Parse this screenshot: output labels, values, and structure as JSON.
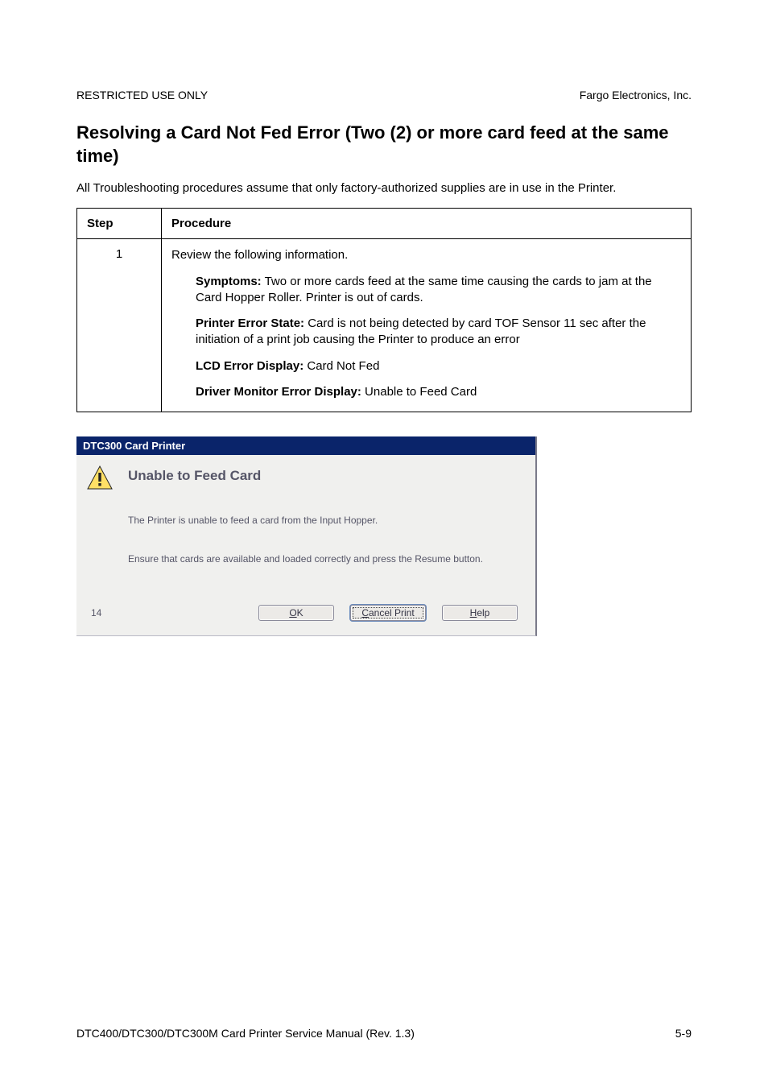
{
  "header": {
    "left": "RESTRICTED USE ONLY",
    "right": "Fargo Electronics, Inc."
  },
  "section_title": "Resolving a Card Not Fed Error (Two (2) or more card feed at the same time)",
  "intro": "All Troubleshooting procedures assume that only factory-authorized supplies are in use in the Printer.",
  "proc_table": {
    "headers": {
      "step": "Step",
      "procedure": "Procedure"
    },
    "row": {
      "step": "1",
      "line1": "Review the following information.",
      "symptoms_label": "Symptoms:",
      "symptoms_text": " Two or more cards feed at the same time causing the cards to jam at the Card Hopper Roller. Printer is out of cards.",
      "error_state_label": "Printer Error State:",
      "error_state_text": " Card is not being detected by card TOF Sensor 11 sec after the initiation of a print job causing the Printer to produce an error",
      "lcd_label": "LCD Error Display:",
      "lcd_text": " Card Not Fed",
      "driver_label": "Driver Monitor Error Display:",
      "driver_text": " Unable to Feed Card"
    }
  },
  "dialog": {
    "title": "DTC300 Card Printer",
    "heading": "Unable to Feed Card",
    "msg1": "The Printer is unable to feed a card from the Input Hopper.",
    "msg2": "Ensure that cards are available and loaded correctly and press the Resume button.",
    "count": "14",
    "buttons": {
      "ok_accesskey": "O",
      "ok_rest": "K",
      "cancel_accesskey": "C",
      "cancel_rest": "ancel Print",
      "help_accesskey": "H",
      "help_rest": "elp"
    }
  },
  "footer": {
    "left": "DTC400/DTC300/DTC300M Card Printer Service Manual (Rev. 1.3)",
    "right": "5-9"
  }
}
